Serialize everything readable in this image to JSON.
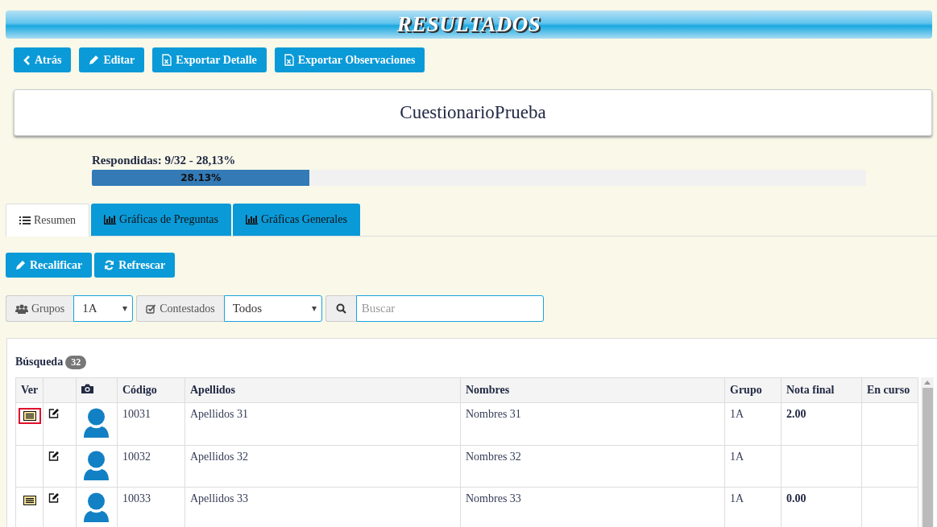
{
  "header": {
    "title": "RESULTADOS"
  },
  "actions": [
    {
      "label": "Atrás",
      "kind": "back"
    },
    {
      "label": "Editar",
      "kind": "edit"
    },
    {
      "label": "Exportar Detalle",
      "kind": "excel"
    },
    {
      "label": "Exportar Observaciones",
      "kind": "excel"
    }
  ],
  "quiz_title": "CuestionarioPrueba",
  "progress": {
    "label": "Respondidas: 9/32 - 28,13%",
    "level": 0.2813,
    "reading": "28.13%"
  },
  "tabs": [
    {
      "label": "Resumen",
      "kind": "list",
      "selected": true
    },
    {
      "label": "Gráficas de Preguntas",
      "kind": "chart",
      "selected": false
    },
    {
      "label": "Gráficas Generales",
      "kind": "chart",
      "selected": false
    }
  ],
  "tools": [
    {
      "label": "Recalificar",
      "kind": "edit"
    },
    {
      "label": "Refrescar",
      "kind": "refresh"
    }
  ],
  "filters": {
    "group_label": "Grupos",
    "group_value": "1A",
    "answered_label": "Contestados",
    "answered_value": "Todos",
    "search_placeholder": "Buscar"
  },
  "results": {
    "title": "Búsqueda",
    "count": "32",
    "columns": [
      "Ver",
      "",
      "",
      "Código",
      "Apellidos",
      "Nombres",
      "Grupo",
      "Nota final",
      "En curso"
    ],
    "rows": [
      {
        "has_view": true,
        "highlighted": true,
        "code": "10031",
        "surname": "Apellidos 31",
        "name": "Nombres 31",
        "group": "1A",
        "grade": "2.00"
      },
      {
        "has_view": false,
        "highlighted": false,
        "code": "10032",
        "surname": "Apellidos 32",
        "name": "Nombres 32",
        "group": "1A",
        "grade": ""
      },
      {
        "has_view": true,
        "highlighted": false,
        "code": "10033",
        "surname": "Apellidos 33",
        "name": "Nombres 33",
        "group": "1A",
        "grade": "0.00"
      }
    ]
  }
}
